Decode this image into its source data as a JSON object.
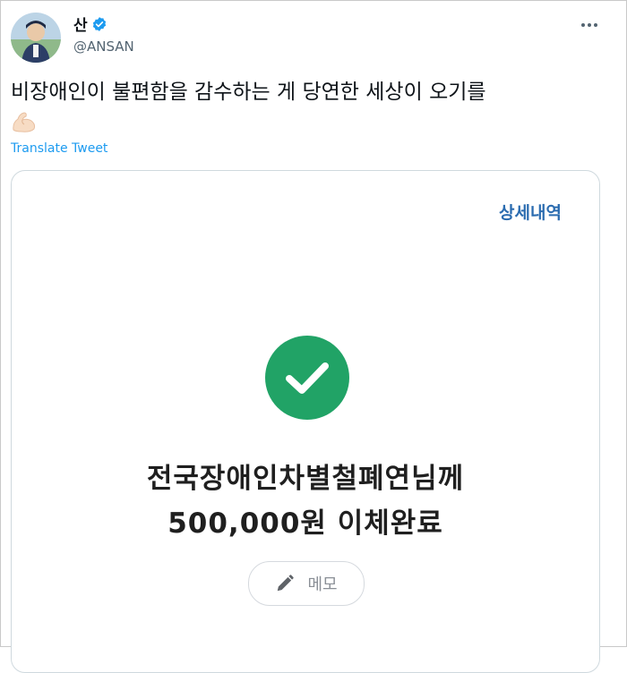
{
  "tweet": {
    "author_name": "산",
    "author_handle": "@ANSAN",
    "more_icon": "ellipsis-icon",
    "text_line1": "비장애인이 불편함을 감수하는 게 당연한 세상이 오기를",
    "emoji": "flexed-biceps-icon",
    "translate_label": "Translate Tweet"
  },
  "card": {
    "detail_label": "상세내역",
    "recipient_text": "전국장애인차별철폐연님께",
    "amount_text": "500,000원 이체완료",
    "memo_label": "메모",
    "memo_icon": "pencil-icon",
    "status_icon": "check-circle-icon"
  },
  "colors": {
    "link_blue": "#1d9bf0",
    "detail_blue": "#2b6cb0",
    "success_green": "#21a366",
    "verified_blue": "#1d9bf0"
  }
}
